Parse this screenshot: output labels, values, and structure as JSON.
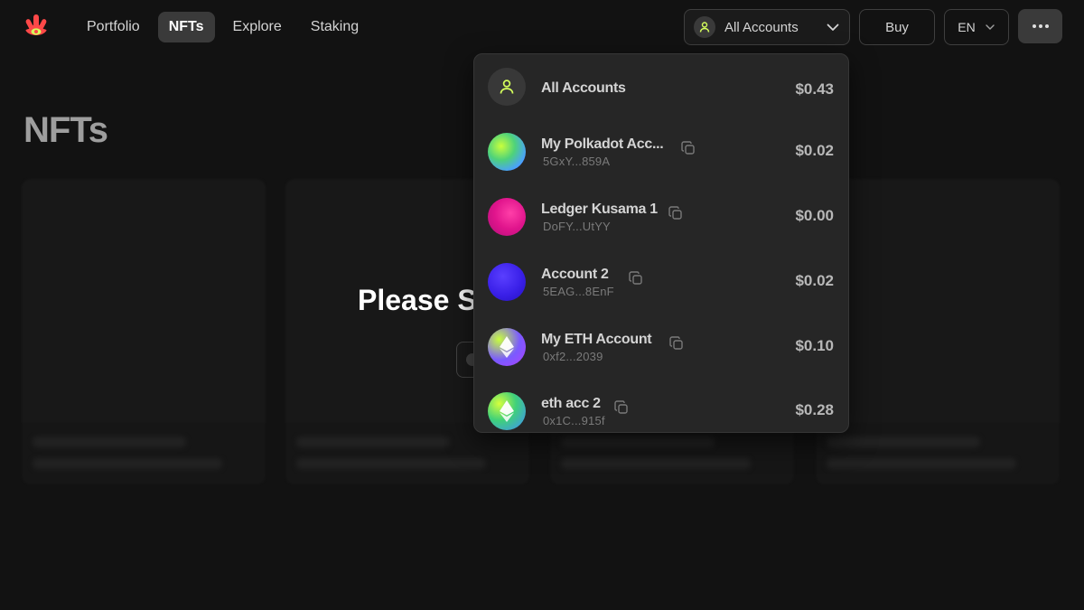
{
  "nav": {
    "items": [
      {
        "label": "Portfolio",
        "active": false
      },
      {
        "label": "NFTs",
        "active": true
      },
      {
        "label": "Explore",
        "active": false
      },
      {
        "label": "Staking",
        "active": false
      }
    ]
  },
  "header": {
    "account_selector_label": "All Accounts",
    "buy_label": "Buy",
    "language": "EN"
  },
  "page": {
    "title": "NFTs",
    "overlay_text": "Please S"
  },
  "dropdown": {
    "accounts": [
      {
        "name": "All Accounts",
        "address": "",
        "value": "$0.43",
        "avatar": "user-icon"
      },
      {
        "name": "My Polkadot Acc...",
        "address": "5GxY...859A",
        "value": "$0.02",
        "avatar": "gradient-avatar"
      },
      {
        "name": "Ledger Kusama 1",
        "address": "DoFY...UtYY",
        "value": "$0.00",
        "avatar": "gradient-avatar"
      },
      {
        "name": "Account 2",
        "address": "5EAG...8EnF",
        "value": "$0.02",
        "avatar": "gradient-avatar"
      },
      {
        "name": "My ETH Account",
        "address": "0xf2...2039",
        "value": "$0.10",
        "avatar": "ethereum-icon"
      },
      {
        "name": "eth acc 2",
        "address": "0x1C...915f",
        "value": "$0.28",
        "avatar": "ethereum-icon"
      }
    ]
  },
  "colors": {
    "background": "#121212",
    "accent": "#d5ff5c",
    "logo": "#fd4848",
    "dropdown_bg": "#262626"
  }
}
